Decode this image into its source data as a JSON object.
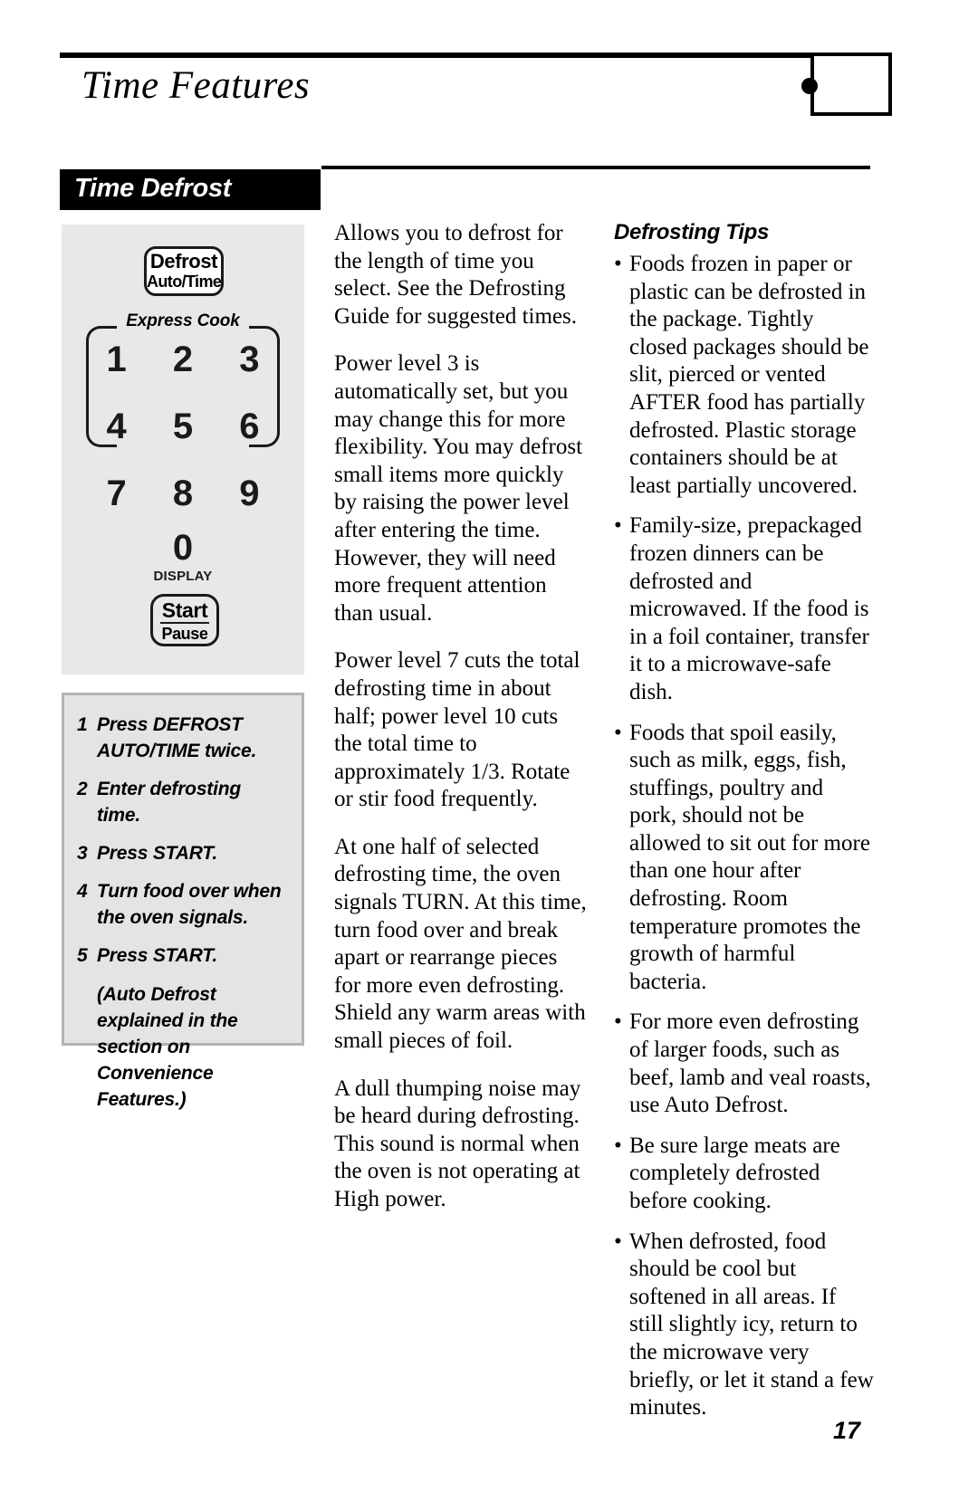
{
  "header": {
    "title": "Time Features",
    "logo_name": "ge-logo"
  },
  "section": {
    "bar_label": "Time Defrost"
  },
  "control_panel": {
    "defrost_button": {
      "line1": "Defrost",
      "line2": "Auto/Time"
    },
    "express_cook_label": "Express Cook",
    "keys": [
      [
        "1",
        "2",
        "3"
      ],
      [
        "4",
        "5",
        "6"
      ],
      [
        "7",
        "8",
        "9"
      ]
    ],
    "zero_key": "0",
    "display_label": "DISPLAY",
    "start_button": {
      "line1": "Start",
      "line2": "Pause"
    }
  },
  "steps": {
    "items": [
      {
        "num": "1",
        "text": "Press DEFROST AUTO/TIME twice."
      },
      {
        "num": "2",
        "text": "Enter defrosting time."
      },
      {
        "num": "3",
        "text": "Press START."
      },
      {
        "num": "4",
        "text": "Turn food over when the oven signals."
      },
      {
        "num": "5",
        "text": "Press START."
      }
    ],
    "note": "(Auto Defrost explained in the section on Convenience Features.)"
  },
  "middle_column": {
    "paragraphs": [
      "Allows you to defrost for the length of time you select. See the Defrosting Guide for suggested times.",
      "Power level 3 is automatically set, but you may change this for more flexibility. You may defrost small items more quickly by raising the power level after entering the time. However, they will need more frequent attention than usual.",
      "Power level 7 cuts the total defrosting time in about half; power level 10 cuts the total time to approximately 1/3. Rotate or stir food frequently.",
      "At one half of selected defrosting time, the oven signals TURN. At this time, turn food over and break apart or rearrange pieces for more even defrosting. Shield any warm areas with small pieces of foil.",
      "A dull thumping noise may be heard during defrosting. This sound is normal when the oven is not operating at High power."
    ]
  },
  "right_column": {
    "heading": "Defrosting Tips",
    "bullet_char": "•",
    "tips": [
      "Foods frozen in paper or plastic can be defrosted in the package. Tightly closed packages should be slit, pierced or vented AFTER food has partially defrosted. Plastic storage containers should be at least partially uncovered.",
      "Family-size, prepackaged frozen dinners can be defrosted and microwaved. If the food is in a foil container, transfer it to a microwave-safe dish.",
      "Foods that spoil easily, such as milk, eggs, fish, stuffings, poultry and pork, should not be allowed to sit out for more than one hour after defrosting. Room temperature promotes the growth of harmful bacteria.",
      "For more even defrosting of larger foods, such as beef, lamb and veal roasts, use Auto Defrost.",
      "Be sure large meats are completely defrosted before cooking.",
      "When defrosted, food should be cool but softened in all areas. If still slightly icy, return to the microwave very briefly, or let it stand a few minutes."
    ]
  },
  "footer": {
    "page_number": "17"
  },
  "colors": {
    "panel_gray": "#e8e8e8",
    "steps_gray": "#e4e4e4",
    "steps_border": "#b3b3b3",
    "bar_black": "#000000"
  }
}
